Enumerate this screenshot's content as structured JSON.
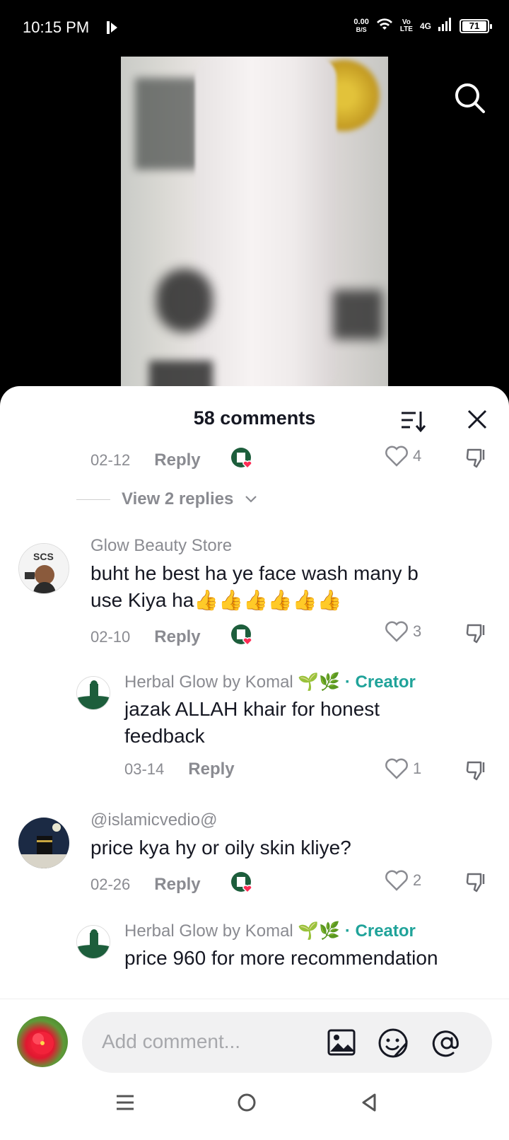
{
  "status_bar": {
    "time": "10:15 PM",
    "speed_value": "0.00",
    "speed_unit": "B/S",
    "volte_top": "Vo",
    "volte_bottom": "LTE",
    "network": "4G",
    "battery": "71"
  },
  "sheet": {
    "title": "58 comments"
  },
  "comments": [
    {
      "id": "c0",
      "date": "02-12",
      "reply_label": "Reply",
      "likes": "4"
    },
    {
      "id": "c1",
      "username": "Glow Beauty Store",
      "text_line1": "buht he best ha ye face wash many b",
      "text_line2": "use Kiya ha👍👍👍👍👍👍",
      "avatar_text": "SCS",
      "date": "02-10",
      "reply_label": "Reply",
      "likes": "3"
    },
    {
      "id": "r1",
      "username": "Herbal Glow by Komal 🌱🌿",
      "creator_label": "· Creator",
      "text_line1": "jazak ALLAH khair for honest",
      "text_line2": "feedback",
      "date": "03-14",
      "reply_label": "Reply",
      "likes": "1"
    },
    {
      "id": "c2",
      "username": "@islamicvedio@",
      "text_line1": "price kya hy or oily skin kliye?",
      "date": "02-26",
      "reply_label": "Reply",
      "likes": "2"
    },
    {
      "id": "r2",
      "username": "Herbal Glow by Komal 🌱🌿",
      "creator_label": "· Creator",
      "text_line1": "price 960 for more recommendation"
    }
  ],
  "view_replies": "View 2 replies",
  "input": {
    "placeholder": "Add comment..."
  },
  "colors": {
    "creator_accent": "#20a39a",
    "muted_text": "#8a8b91",
    "heart_red": "#fe2c55"
  }
}
